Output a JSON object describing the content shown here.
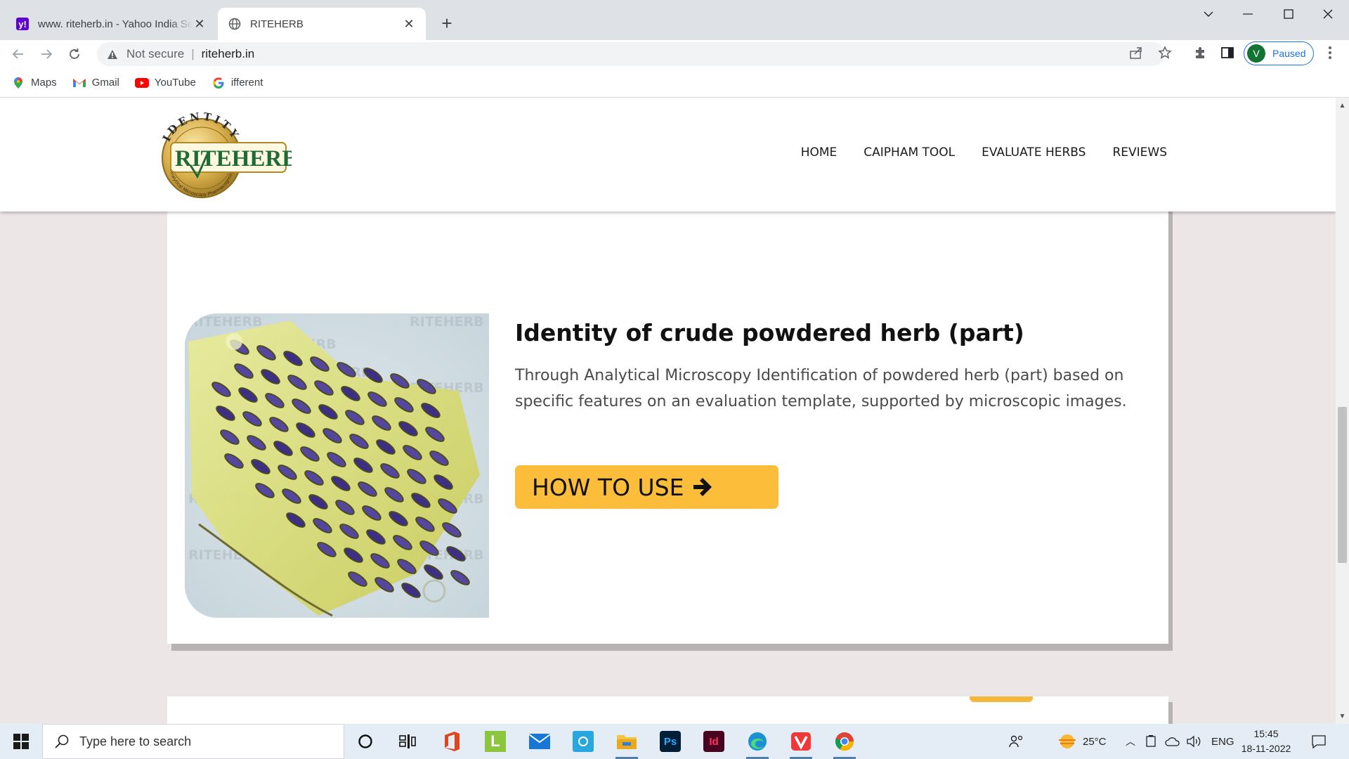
{
  "browser": {
    "tabs": [
      {
        "title": "www. riteherb.in - Yahoo India Se",
        "active": false,
        "favicon": "yahoo-favicon"
      },
      {
        "title": "RITEHERB",
        "active": true,
        "favicon": "globe-icon"
      }
    ],
    "new_tab": "+",
    "window_controls": [
      "chevron-down-icon",
      "minimize-icon",
      "maximize-icon",
      "close-icon"
    ],
    "address": {
      "security_label": "Not secure",
      "url": "riteherb.in"
    },
    "profile": {
      "initial": "V",
      "status": "Paused"
    },
    "bookmarks": [
      {
        "label": "Maps",
        "icon": "maps-icon"
      },
      {
        "label": "Gmail",
        "icon": "gmail-icon"
      },
      {
        "label": "YouTube",
        "icon": "youtube-icon"
      },
      {
        "label": "ifferent",
        "icon": "google-icon"
      }
    ]
  },
  "site": {
    "logo": {
      "top_text": "IDENTITY",
      "brand": "RITEHERB",
      "ring_text": "Analytical Microscopy Pharmacognosy"
    },
    "nav": [
      "HOME",
      "CAIPHAM TOOL",
      "EVALUATE HERBS",
      "REVIEWS"
    ],
    "card": {
      "title": "Identity of crude powdered herb (part)",
      "description": "Through Analytical Microscopy Identification of powdered herb (part) based on specific features on an evaluation template, supported by microscopic images.",
      "button_label": "HOW TO USE",
      "watermark": "RITEHERB"
    }
  },
  "taskbar": {
    "search_placeholder": "Type here to search",
    "apps": [
      "cortana-icon",
      "task-view-icon",
      "office-icon",
      "l-app-icon",
      "mail-icon",
      "app-icon",
      "file-explorer-icon",
      "photoshop-icon",
      "indesign-icon",
      "edge-icon",
      "vivaldi-icon",
      "chrome-icon"
    ],
    "weather": "25°C",
    "language": "ENG",
    "time": "15:45",
    "date": "18-11-2022"
  },
  "colors": {
    "accent_button": "#fbbd3a",
    "page_bg": "#ece6e6",
    "profile_blue": "#1a73e8"
  }
}
